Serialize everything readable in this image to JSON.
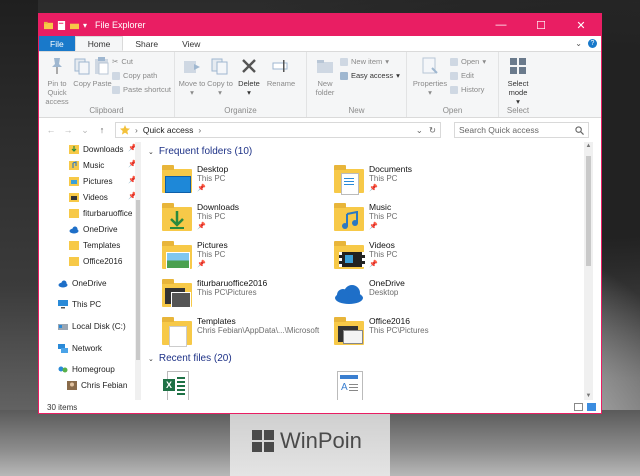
{
  "window": {
    "title": "File Explorer",
    "accent": "#e91e63",
    "controls": [
      "minimize",
      "maximize",
      "close"
    ]
  },
  "ribbon": {
    "tabs": [
      {
        "label": "File"
      },
      {
        "label": "Home"
      },
      {
        "label": "Share"
      },
      {
        "label": "View"
      }
    ],
    "groups": {
      "clipboard": {
        "label": "Clipboard",
        "pin": "Pin to Quick access",
        "copy": "Copy",
        "paste": "Paste",
        "cut": "Cut",
        "copy_path": "Copy path",
        "paste_shortcut": "Paste shortcut"
      },
      "organize": {
        "label": "Organize",
        "move_to": "Move to",
        "copy_to": "Copy to",
        "delete": "Delete",
        "rename": "Rename"
      },
      "new": {
        "label": "New",
        "new_folder": "New folder",
        "new_item": "New item",
        "easy_access": "Easy access"
      },
      "open": {
        "label": "Open",
        "properties": "Properties",
        "open": "Open",
        "edit": "Edit",
        "history": "History"
      },
      "select": {
        "label": "Select",
        "select_mode": "Select mode"
      }
    }
  },
  "address": {
    "crumb": "Quick access",
    "search_placeholder": "Search Quick access"
  },
  "nav": {
    "quick_items": [
      {
        "label": "Downloads",
        "icon": "downloads-icon",
        "pinned": true
      },
      {
        "label": "Music",
        "icon": "music-icon",
        "pinned": true
      },
      {
        "label": "Pictures",
        "icon": "pictures-icon",
        "pinned": true
      },
      {
        "label": "Videos",
        "icon": "videos-icon",
        "pinned": true
      },
      {
        "label": "fiturbaruoffice",
        "icon": "folder-icon",
        "pinned": false
      },
      {
        "label": "OneDrive",
        "icon": "onedrive-icon",
        "pinned": false
      },
      {
        "label": "Templates",
        "icon": "folder-icon",
        "pinned": false
      },
      {
        "label": "Office2016",
        "icon": "folder-icon",
        "pinned": false
      }
    ],
    "roots": [
      {
        "label": "OneDrive",
        "icon": "onedrive-icon"
      },
      {
        "label": "This PC",
        "icon": "this-pc-icon"
      },
      {
        "label": "Local Disk (C:)",
        "icon": "disk-icon"
      },
      {
        "label": "Network",
        "icon": "network-icon"
      },
      {
        "label": "Homegroup",
        "icon": "homegroup-icon"
      },
      {
        "label": "Chris Febian",
        "icon": "user-icon"
      }
    ]
  },
  "content": {
    "frequent_header": "Frequent folders (10)",
    "recent_header": "Recent files (20)",
    "folders": [
      {
        "name": "Desktop",
        "location": "This PC",
        "pinned": true
      },
      {
        "name": "Documents",
        "location": "This PC",
        "pinned": true
      },
      {
        "name": "Downloads",
        "location": "This PC",
        "pinned": true
      },
      {
        "name": "Music",
        "location": "This PC",
        "pinned": true
      },
      {
        "name": "Pictures",
        "location": "This PC",
        "pinned": true
      },
      {
        "name": "Videos",
        "location": "This PC",
        "pinned": true
      },
      {
        "name": "fiturbaruoffice2016",
        "location": "This PC\\Pictures",
        "pinned": false
      },
      {
        "name": "OneDrive",
        "location": "Desktop",
        "pinned": false
      },
      {
        "name": "Templates",
        "location": "Chris Febian\\AppData\\...\\Microsoft",
        "pinned": false
      },
      {
        "name": "Office2016",
        "location": "This PC\\Pictures",
        "pinned": false
      }
    ]
  },
  "status": {
    "item_count": "30 items"
  },
  "watermark": {
    "text": "WinPoin"
  }
}
